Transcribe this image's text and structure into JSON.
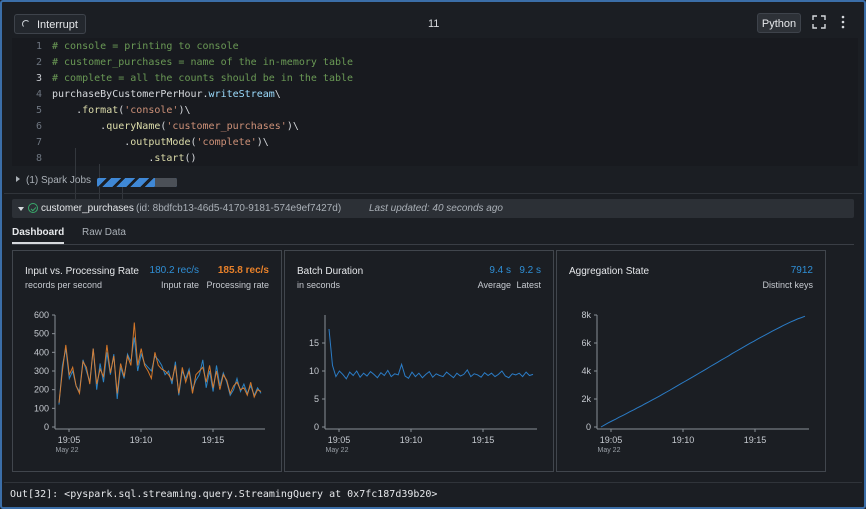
{
  "toolbar": {
    "interrupt_label": "Interrupt",
    "cell_number": "11",
    "language_label": "Python"
  },
  "code": {
    "lines": [
      {
        "n": "1",
        "text": "# console = printing to console"
      },
      {
        "n": "2",
        "text": "# customer_purchases = name of the in-memory table"
      },
      {
        "n": "3",
        "text": "# complete = all the counts should be in the table"
      },
      {
        "n": "4",
        "text": "purchaseByCustomerPerHour.writeStream\\"
      },
      {
        "n": "5",
        "text": "    .format('console')\\"
      },
      {
        "n": "6",
        "text": "        .queryName('customer_purchases')\\"
      },
      {
        "n": "7",
        "text": "            .outputMode('complete')\\"
      },
      {
        "n": "8",
        "text": "                .start()"
      }
    ]
  },
  "spark_jobs": {
    "label": "(1) Spark Jobs",
    "progress": 0.72
  },
  "query": {
    "name": "customer_purchases",
    "id": "(id: 8bdfcb13-46d5-4170-9181-574e9ef7427d)",
    "last_updated": "Last updated: 40 seconds ago"
  },
  "tabs": [
    {
      "label": "Dashboard",
      "active": true
    },
    {
      "label": "Raw Data",
      "active": false
    }
  ],
  "colors": {
    "input": "#2f8fd6",
    "processing": "#e8812a",
    "line": "#2b7cc6",
    "frame": "#3b6ea8"
  },
  "panels": {
    "input_processing": {
      "title": "Input vs. Processing Rate",
      "subtitle": "records per second",
      "input_value": "180.2 rec/s",
      "input_label": "Input rate",
      "processing_value": "185.8 rec/s",
      "processing_label": "Processing rate"
    },
    "batch_duration": {
      "title": "Batch Duration",
      "subtitle": "in seconds",
      "average_value": "9.4 s",
      "average_label": "Average",
      "latest_value": "9.2 s",
      "latest_label": "Latest"
    },
    "aggregation": {
      "title": "Aggregation State",
      "distinct_value": "7912",
      "distinct_label": "Distinct keys"
    }
  },
  "chart_data": [
    {
      "type": "line",
      "ylim": [
        0,
        600
      ],
      "yticks": [
        "0",
        "100",
        "200",
        "300",
        "400",
        "500",
        "600"
      ],
      "xticks": [
        "19:05",
        "19:10",
        "19:15"
      ],
      "xtick_sub": "May 22",
      "series": [
        {
          "name": "Input rate",
          "values": [
            120,
            330,
            420,
            260,
            300,
            220,
            190,
            360,
            300,
            240,
            420,
            200,
            340,
            240,
            400,
            280,
            390,
            150,
            320,
            260,
            390,
            350,
            480,
            300,
            390,
            340,
            320,
            300,
            380,
            360,
            330,
            280,
            300,
            230,
            350,
            170,
            300,
            260,
            310,
            200,
            250,
            280,
            360,
            210,
            300,
            190,
            330,
            220,
            290,
            240,
            170,
            200,
            260,
            190,
            230,
            180,
            220,
            170,
            210,
            180
          ]
        },
        {
          "name": "Processing rate",
          "values": [
            130,
            300,
            440,
            280,
            320,
            220,
            180,
            350,
            320,
            230,
            420,
            230,
            310,
            270,
            440,
            290,
            380,
            180,
            340,
            270,
            380,
            330,
            560,
            330,
            420,
            330,
            300,
            260,
            400,
            330,
            310,
            300,
            280,
            250,
            330,
            180,
            320,
            240,
            300,
            180,
            280,
            300,
            320,
            240,
            330,
            210,
            300,
            200,
            280,
            250,
            180,
            220,
            240,
            200,
            210,
            170,
            240,
            160,
            200,
            190
          ]
        }
      ]
    },
    {
      "type": "line",
      "ylim": [
        0,
        20
      ],
      "yticks": [
        "0",
        "5",
        "10",
        "15"
      ],
      "xticks": [
        "19:05",
        "19:10",
        "19:15"
      ],
      "xtick_sub": "May 22",
      "series": [
        {
          "name": "Batch duration",
          "values": [
            17.5,
            11.0,
            9.0,
            10.0,
            9.4,
            8.6,
            9.8,
            9.2,
            10.0,
            8.9,
            9.6,
            9.1,
            9.9,
            9.4,
            8.8,
            9.7,
            9.2,
            10.1,
            9.0,
            9.5,
            9.3,
            11.2,
            9.1,
            8.7,
            9.8,
            9.0,
            9.6,
            8.8,
            9.4,
            9.9,
            8.9,
            9.5,
            9.2,
            9.0,
            9.8,
            9.3,
            8.8,
            9.6,
            9.1,
            9.4,
            10.2,
            9.0,
            9.5,
            9.3,
            8.9,
            9.7,
            9.2,
            9.6,
            9.0,
            9.4,
            10.0,
            9.1,
            8.8,
            9.5,
            9.3,
            9.6,
            9.0,
            9.8,
            9.2,
            9.4
          ]
        }
      ]
    },
    {
      "type": "line",
      "ylim": [
        0,
        8000
      ],
      "yticks": [
        "0",
        "2k",
        "4k",
        "6k",
        "8k"
      ],
      "xticks": [
        "19:05",
        "19:10",
        "19:15"
      ],
      "xtick_sub": "May 22",
      "series": [
        {
          "name": "Distinct keys",
          "values": [
            0,
            150,
            300,
            430,
            560,
            700,
            830,
            960,
            1100,
            1230,
            1370,
            1500,
            1640,
            1780,
            1920,
            2060,
            2200,
            2350,
            2500,
            2640,
            2800,
            2950,
            3100,
            3250,
            3400,
            3550,
            3700,
            3860,
            4010,
            4160,
            4320,
            4470,
            4620,
            4780,
            4930,
            5080,
            5240,
            5390,
            5540,
            5690,
            5840,
            5990,
            6130,
            6280,
            6420,
            6560,
            6700,
            6840,
            6980,
            7110,
            7240,
            7370,
            7490,
            7610,
            7720,
            7812,
            7912
          ]
        }
      ]
    }
  ],
  "output": {
    "text": "Out[32]: <pyspark.sql.streaming.query.StreamingQuery at 0x7fc187d39b20>"
  }
}
